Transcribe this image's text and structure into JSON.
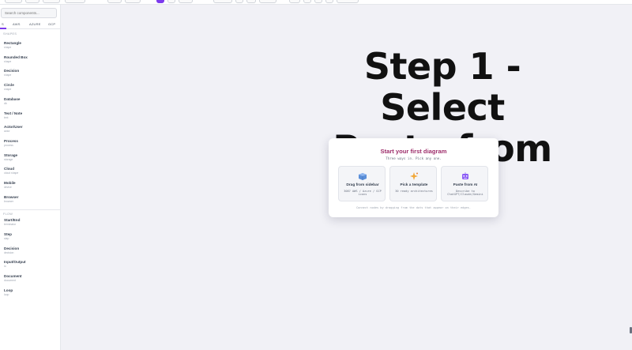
{
  "sidebar": {
    "search_placeholder": "Search components...",
    "tabs": [
      "S",
      "AWS",
      "AZURE",
      "GCP"
    ],
    "sections": [
      {
        "label": "SHAPES",
        "items": [
          {
            "title": "Rectangle",
            "sub": "shape"
          },
          {
            "title": "Rounded Box",
            "sub": "shape"
          },
          {
            "title": "Decision",
            "sub": "shape"
          },
          {
            "title": "Circle",
            "sub": "shape"
          },
          {
            "title": "Database",
            "sub": "db"
          },
          {
            "title": "Text / Note",
            "sub": "text"
          },
          {
            "title": "Actor/User",
            "sub": "actor"
          },
          {
            "title": "Process",
            "sub": "process"
          },
          {
            "title": "Storage",
            "sub": "storage"
          },
          {
            "title": "Cloud",
            "sub": "cloud shape"
          },
          {
            "title": "Mobile",
            "sub": "device"
          },
          {
            "title": "Browser",
            "sub": "browser"
          }
        ]
      },
      {
        "label": "FLOW",
        "items": [
          {
            "title": "Start/End",
            "sub": "terminator"
          },
          {
            "title": "Step",
            "sub": "step"
          },
          {
            "title": "Decision",
            "sub": "decision"
          },
          {
            "title": "Input/Output",
            "sub": "io"
          },
          {
            "title": "Document",
            "sub": "document"
          },
          {
            "title": "Loop",
            "sub": "loop"
          }
        ]
      }
    ]
  },
  "heading": {
    "line1": "Step 1 - Select",
    "line2": "Paste from AI"
  },
  "card": {
    "title": "Start your first diagram",
    "subtitle": "Three ways in. Pick any one.",
    "options": [
      {
        "icon": "cube-icon",
        "title": "Drag from sidebar",
        "desc": "3087 AWS / Azure / GCP icons"
      },
      {
        "icon": "sparkle-icon",
        "title": "Pick a template",
        "desc": "30 ready architectures"
      },
      {
        "icon": "robot-icon",
        "title": "Paste from AI",
        "desc": "Describe to ChatGPT/Claude/Gemini"
      }
    ],
    "footer": "Connect nodes by dragging from the dots that appear on their edges."
  },
  "colors": {
    "accent": "#7c3aed",
    "card_title": "#9d2d6a",
    "canvas": "#f1f1f6"
  }
}
